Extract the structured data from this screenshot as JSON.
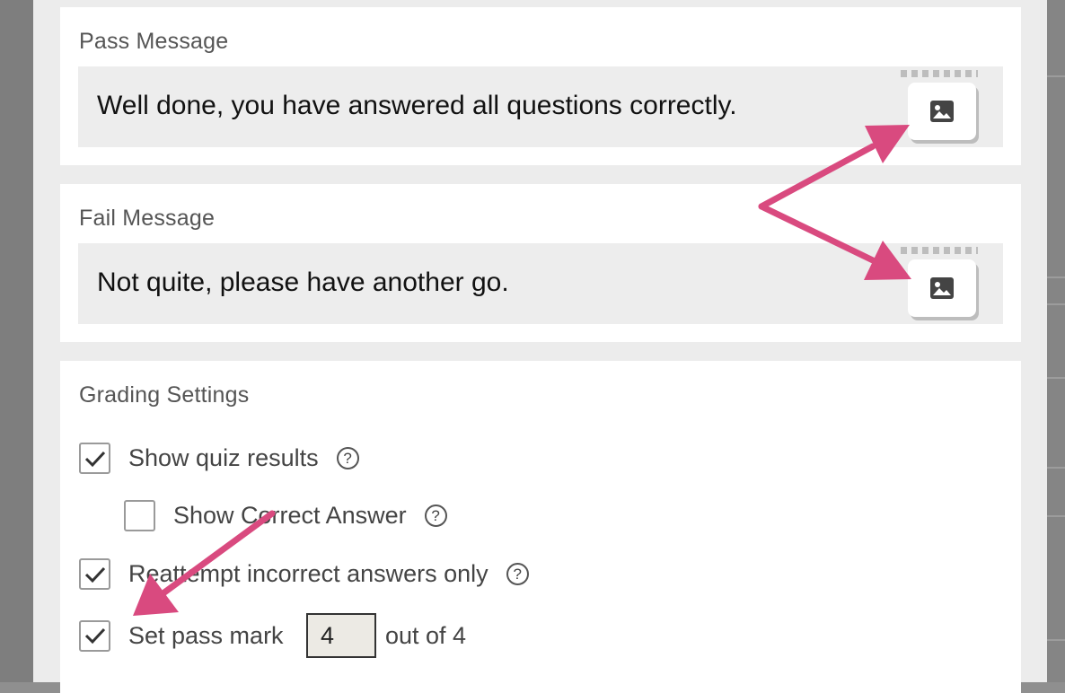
{
  "pass_card": {
    "title": "Pass Message",
    "message": "Well done, you have answered all questions correctly.",
    "image_button_icon": "image-icon"
  },
  "fail_card": {
    "title": "Fail Message",
    "message": "Not quite, please have another go.",
    "image_button_icon": "image-icon"
  },
  "grading": {
    "title": "Grading Settings",
    "show_quiz_results": {
      "label": "Show quiz results",
      "checked": true
    },
    "show_correct_answer": {
      "label": "Show Correct Answer",
      "checked": false
    },
    "reattempt_incorrect": {
      "label": "Reattempt incorrect answers only",
      "checked": true
    },
    "set_pass_mark": {
      "label": "Set pass mark",
      "checked": true,
      "value": "4",
      "suffix": "out of 4"
    },
    "help_glyph": "?"
  },
  "annotation": {
    "arrow_color": "#d94a7f"
  }
}
